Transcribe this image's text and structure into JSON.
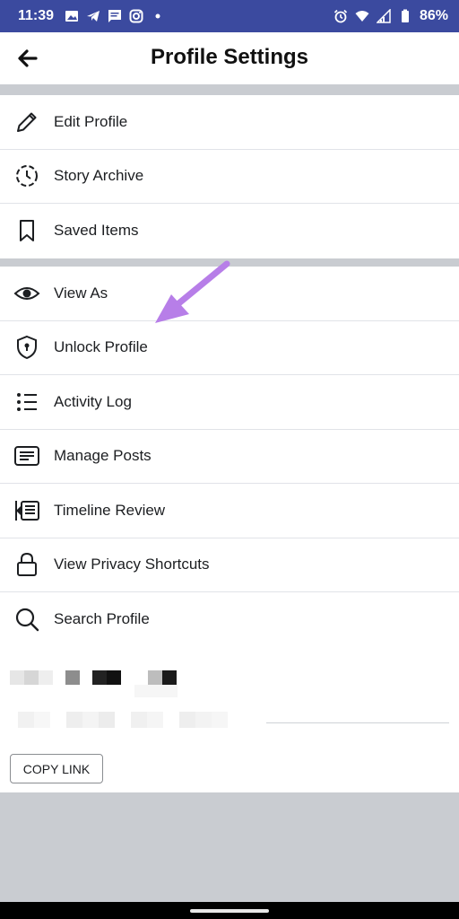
{
  "status": {
    "time": "11:39",
    "battery": "86%",
    "icons": [
      "image-icon",
      "telegram-icon",
      "message-icon",
      "instagram-icon",
      "dot-icon",
      "alarm-icon",
      "wifi-icon",
      "signal-icon",
      "battery-icon"
    ]
  },
  "header": {
    "title": "Profile Settings",
    "back_icon": "back-arrow-icon"
  },
  "groups": [
    {
      "items": [
        {
          "label": "Edit Profile",
          "icon": "pencil-icon"
        },
        {
          "label": "Story Archive",
          "icon": "story-archive-icon"
        },
        {
          "label": "Saved Items",
          "icon": "bookmark-icon"
        }
      ]
    },
    {
      "items": [
        {
          "label": "View As",
          "icon": "eye-icon"
        },
        {
          "label": "Unlock Profile",
          "icon": "shield-lock-icon"
        },
        {
          "label": "Activity Log",
          "icon": "list-icon"
        },
        {
          "label": "Manage Posts",
          "icon": "posts-icon"
        },
        {
          "label": "Timeline Review",
          "icon": "timeline-review-icon"
        },
        {
          "label": "View Privacy Shortcuts",
          "icon": "lock-icon"
        },
        {
          "label": "Search Profile",
          "icon": "search-icon"
        }
      ]
    }
  ],
  "profile_link": {
    "copy_label": "COPY LINK"
  },
  "colors": {
    "status_bar": "#3b4a9f",
    "divider": "#c9ccd1",
    "annotation_arrow": "#b77ee8"
  }
}
